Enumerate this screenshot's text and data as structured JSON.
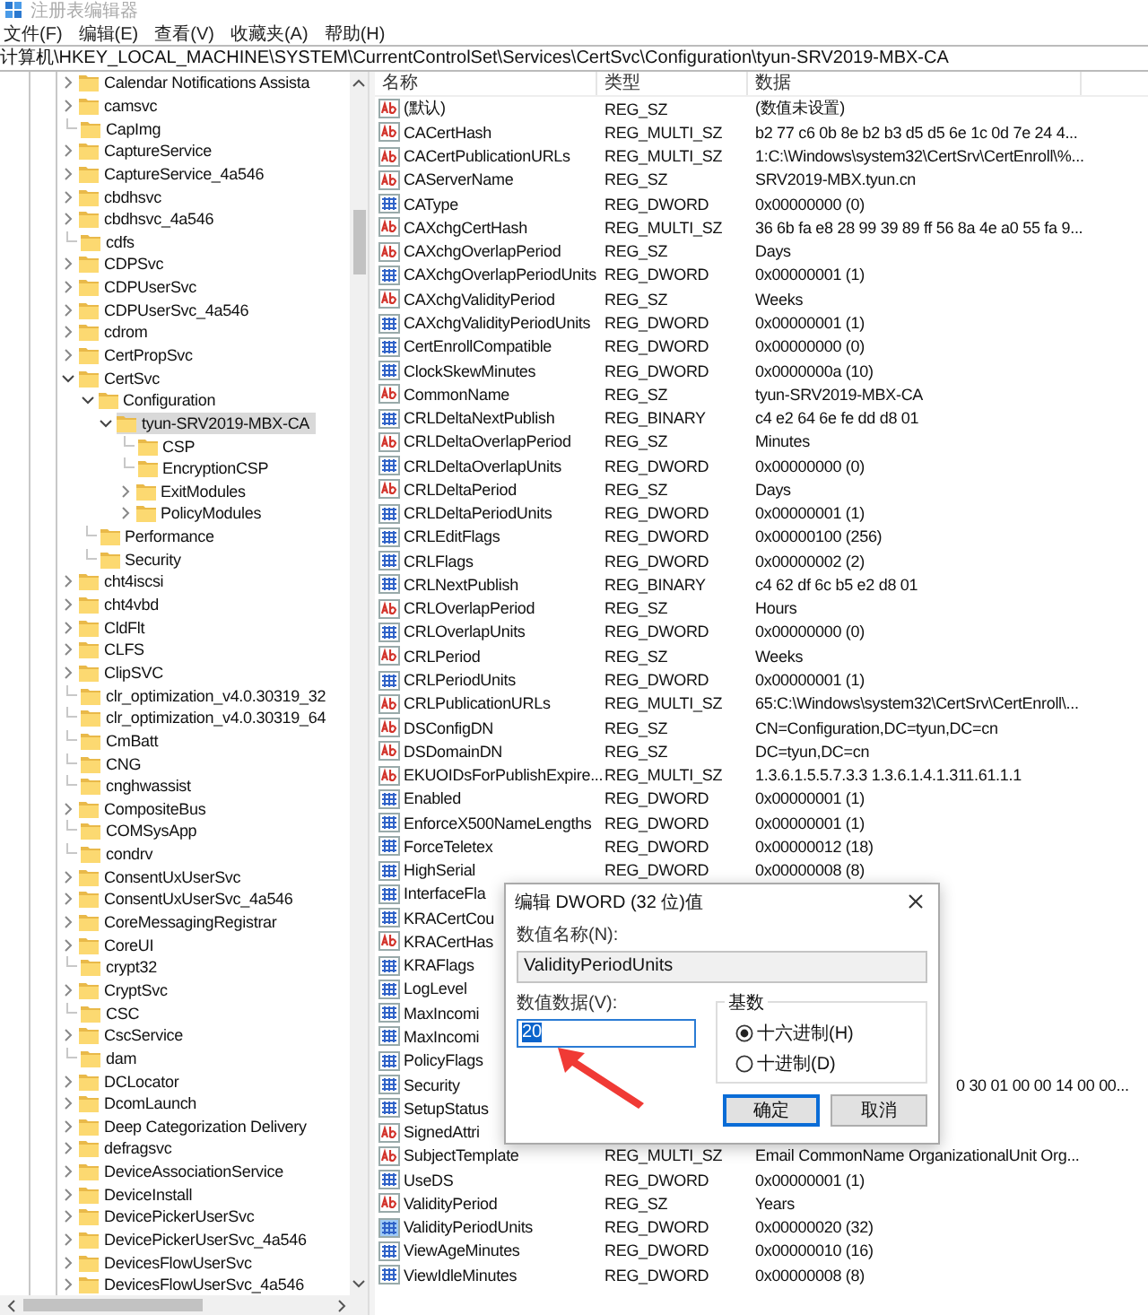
{
  "window": {
    "title": "注册表编辑器"
  },
  "menu": [
    "文件(F)",
    "编辑(E)",
    "查看(V)",
    "收藏夹(A)",
    "帮助(H)"
  ],
  "address": "计算机\\HKEY_LOCAL_MACHINE\\SYSTEM\\CurrentControlSet\\Services\\CertSvc\\Configuration\\tyun-SRV2019-MBX-CA",
  "tree": {
    "items": [
      {
        "label": "Calendar Notifications Assista",
        "kind": "collapsed",
        "selected": false
      },
      {
        "label": "camsvc",
        "kind": "collapsed",
        "selected": false
      },
      {
        "label": "CapImg",
        "kind": "leaf",
        "selected": false
      },
      {
        "label": "CaptureService",
        "kind": "collapsed",
        "selected": false
      },
      {
        "label": "CaptureService_4a546",
        "kind": "collapsed",
        "selected": false
      },
      {
        "label": "cbdhsvc",
        "kind": "collapsed",
        "selected": false
      },
      {
        "label": "cbdhsvc_4a546",
        "kind": "collapsed",
        "selected": false
      },
      {
        "label": "cdfs",
        "kind": "leaf",
        "selected": false
      },
      {
        "label": "CDPSvc",
        "kind": "collapsed",
        "selected": false
      },
      {
        "label": "CDPUserSvc",
        "kind": "collapsed",
        "selected": false
      },
      {
        "label": "CDPUserSvc_4a546",
        "kind": "collapsed",
        "selected": false
      },
      {
        "label": "cdrom",
        "kind": "collapsed",
        "selected": false
      },
      {
        "label": "CertPropSvc",
        "kind": "collapsed",
        "selected": false
      },
      {
        "label": "CertSvc",
        "kind": "expanded",
        "selected": false,
        "children": [
          {
            "label": "Configuration",
            "kind": "expanded",
            "selected": false,
            "children": [
              {
                "label": "tyun-SRV2019-MBX-CA",
                "kind": "expanded",
                "selected": true,
                "children": [
                  {
                    "label": "CSP",
                    "kind": "leaf",
                    "selected": false
                  },
                  {
                    "label": "EncryptionCSP",
                    "kind": "leaf",
                    "selected": false
                  },
                  {
                    "label": "ExitModules",
                    "kind": "collapsed",
                    "selected": false
                  },
                  {
                    "label": "PolicyModules",
                    "kind": "collapsed",
                    "selected": false
                  }
                ]
              }
            ]
          },
          {
            "label": "Performance",
            "kind": "leaf",
            "selected": false
          },
          {
            "label": "Security",
            "kind": "leaf",
            "selected": false
          }
        ]
      },
      {
        "label": "cht4iscsi",
        "kind": "collapsed",
        "selected": false
      },
      {
        "label": "cht4vbd",
        "kind": "collapsed",
        "selected": false
      },
      {
        "label": "CldFlt",
        "kind": "collapsed",
        "selected": false
      },
      {
        "label": "CLFS",
        "kind": "collapsed",
        "selected": false
      },
      {
        "label": "ClipSVC",
        "kind": "collapsed",
        "selected": false
      },
      {
        "label": "clr_optimization_v4.0.30319_32",
        "kind": "leaf",
        "selected": false
      },
      {
        "label": "clr_optimization_v4.0.30319_64",
        "kind": "leaf",
        "selected": false
      },
      {
        "label": "CmBatt",
        "kind": "leaf",
        "selected": false
      },
      {
        "label": "CNG",
        "kind": "leaf",
        "selected": false
      },
      {
        "label": "cnghwassist",
        "kind": "leaf",
        "selected": false
      },
      {
        "label": "CompositeBus",
        "kind": "collapsed",
        "selected": false
      },
      {
        "label": "COMSysApp",
        "kind": "leaf",
        "selected": false
      },
      {
        "label": "condrv",
        "kind": "leaf",
        "selected": false
      },
      {
        "label": "ConsentUxUserSvc",
        "kind": "collapsed",
        "selected": false
      },
      {
        "label": "ConsentUxUserSvc_4a546",
        "kind": "collapsed",
        "selected": false
      },
      {
        "label": "CoreMessagingRegistrar",
        "kind": "collapsed",
        "selected": false
      },
      {
        "label": "CoreUI",
        "kind": "collapsed",
        "selected": false
      },
      {
        "label": "crypt32",
        "kind": "leaf",
        "selected": false
      },
      {
        "label": "CryptSvc",
        "kind": "collapsed",
        "selected": false
      },
      {
        "label": "CSC",
        "kind": "leaf",
        "selected": false
      },
      {
        "label": "CscService",
        "kind": "collapsed",
        "selected": false
      },
      {
        "label": "dam",
        "kind": "leaf",
        "selected": false
      },
      {
        "label": "DCLocator",
        "kind": "collapsed",
        "selected": false
      },
      {
        "label": "DcomLaunch",
        "kind": "collapsed",
        "selected": false
      },
      {
        "label": "Deep Categorization Delivery",
        "kind": "collapsed",
        "selected": false
      },
      {
        "label": "defragsvc",
        "kind": "collapsed",
        "selected": false
      },
      {
        "label": "DeviceAssociationService",
        "kind": "collapsed",
        "selected": false
      },
      {
        "label": "DeviceInstall",
        "kind": "collapsed",
        "selected": false
      },
      {
        "label": "DevicePickerUserSvc",
        "kind": "collapsed",
        "selected": false
      },
      {
        "label": "DevicePickerUserSvc_4a546",
        "kind": "collapsed",
        "selected": false
      },
      {
        "label": "DevicesFlowUserSvc",
        "kind": "collapsed",
        "selected": false
      },
      {
        "label": "DevicesFlowUserSvc_4a546",
        "kind": "collapsed",
        "selected": false
      }
    ]
  },
  "values": {
    "columns": [
      "名称",
      "类型",
      "数据"
    ],
    "rows": [
      {
        "kind": "string",
        "name": "(默认)",
        "type": "REG_SZ",
        "data": "(数值未设置)",
        "selected": false
      },
      {
        "kind": "string",
        "name": "CACertHash",
        "type": "REG_MULTI_SZ",
        "data": "b2 77 c6 0b 8e b2 b3 d5 d5 6e 1c 0d 7e 24 4...",
        "selected": false
      },
      {
        "kind": "string",
        "name": "CACertPublicationURLs",
        "type": "REG_MULTI_SZ",
        "data": "1:C:\\Windows\\system32\\CertSrv\\CertEnroll\\%...",
        "selected": false
      },
      {
        "kind": "string",
        "name": "CAServerName",
        "type": "REG_SZ",
        "data": "SRV2019-MBX.tyun.cn",
        "selected": false
      },
      {
        "kind": "number",
        "name": "CAType",
        "type": "REG_DWORD",
        "data": "0x00000000 (0)",
        "selected": false
      },
      {
        "kind": "string",
        "name": "CAXchgCertHash",
        "type": "REG_MULTI_SZ",
        "data": "36 6b fa e8 28 99 39 89 ff 56 8a 4e a0 55 fa 9...",
        "selected": false
      },
      {
        "kind": "string",
        "name": "CAXchgOverlapPeriod",
        "type": "REG_SZ",
        "data": "Days",
        "selected": false
      },
      {
        "kind": "number",
        "name": "CAXchgOverlapPeriodUnits",
        "type": "REG_DWORD",
        "data": "0x00000001 (1)",
        "selected": false
      },
      {
        "kind": "string",
        "name": "CAXchgValidityPeriod",
        "type": "REG_SZ",
        "data": "Weeks",
        "selected": false
      },
      {
        "kind": "number",
        "name": "CAXchgValidityPeriodUnits",
        "type": "REG_DWORD",
        "data": "0x00000001 (1)",
        "selected": false
      },
      {
        "kind": "number",
        "name": "CertEnrollCompatible",
        "type": "REG_DWORD",
        "data": "0x00000000 (0)",
        "selected": false
      },
      {
        "kind": "number",
        "name": "ClockSkewMinutes",
        "type": "REG_DWORD",
        "data": "0x0000000a (10)",
        "selected": false
      },
      {
        "kind": "string",
        "name": "CommonName",
        "type": "REG_SZ",
        "data": "tyun-SRV2019-MBX-CA",
        "selected": false
      },
      {
        "kind": "number",
        "name": "CRLDeltaNextPublish",
        "type": "REG_BINARY",
        "data": "c4 e2 64 6e fe dd d8 01",
        "selected": false
      },
      {
        "kind": "string",
        "name": "CRLDeltaOverlapPeriod",
        "type": "REG_SZ",
        "data": "Minutes",
        "selected": false
      },
      {
        "kind": "number",
        "name": "CRLDeltaOverlapUnits",
        "type": "REG_DWORD",
        "data": "0x00000000 (0)",
        "selected": false
      },
      {
        "kind": "string",
        "name": "CRLDeltaPeriod",
        "type": "REG_SZ",
        "data": "Days",
        "selected": false
      },
      {
        "kind": "number",
        "name": "CRLDeltaPeriodUnits",
        "type": "REG_DWORD",
        "data": "0x00000001 (1)",
        "selected": false
      },
      {
        "kind": "number",
        "name": "CRLEditFlags",
        "type": "REG_DWORD",
        "data": "0x00000100 (256)",
        "selected": false
      },
      {
        "kind": "number",
        "name": "CRLFlags",
        "type": "REG_DWORD",
        "data": "0x00000002 (2)",
        "selected": false
      },
      {
        "kind": "number",
        "name": "CRLNextPublish",
        "type": "REG_BINARY",
        "data": "c4 62 df 6c b5 e2 d8 01",
        "selected": false
      },
      {
        "kind": "string",
        "name": "CRLOverlapPeriod",
        "type": "REG_SZ",
        "data": "Hours",
        "selected": false
      },
      {
        "kind": "number",
        "name": "CRLOverlapUnits",
        "type": "REG_DWORD",
        "data": "0x00000000 (0)",
        "selected": false
      },
      {
        "kind": "string",
        "name": "CRLPeriod",
        "type": "REG_SZ",
        "data": "Weeks",
        "selected": false
      },
      {
        "kind": "number",
        "name": "CRLPeriodUnits",
        "type": "REG_DWORD",
        "data": "0x00000001 (1)",
        "selected": false
      },
      {
        "kind": "string",
        "name": "CRLPublicationURLs",
        "type": "REG_MULTI_SZ",
        "data": "65:C:\\Windows\\system32\\CertSrv\\CertEnroll\\...",
        "selected": false
      },
      {
        "kind": "string",
        "name": "DSConfigDN",
        "type": "REG_SZ",
        "data": "CN=Configuration,DC=tyun,DC=cn",
        "selected": false
      },
      {
        "kind": "string",
        "name": "DSDomainDN",
        "type": "REG_SZ",
        "data": "DC=tyun,DC=cn",
        "selected": false
      },
      {
        "kind": "string",
        "name": "EKUOIDsForPublishExpire...",
        "type": "REG_MULTI_SZ",
        "data": "1.3.6.1.5.5.7.3.3 1.3.6.1.4.1.311.61.1.1",
        "selected": false
      },
      {
        "kind": "number",
        "name": "Enabled",
        "type": "REG_DWORD",
        "data": "0x00000001 (1)",
        "selected": false
      },
      {
        "kind": "number",
        "name": "EnforceX500NameLengths",
        "type": "REG_DWORD",
        "data": "0x00000001 (1)",
        "selected": false
      },
      {
        "kind": "number",
        "name": "ForceTeletex",
        "type": "REG_DWORD",
        "data": "0x00000012 (18)",
        "selected": false
      },
      {
        "kind": "number",
        "name": "HighSerial",
        "type": "REG_DWORD",
        "data": "0x00000008 (8)",
        "selected": false
      },
      {
        "kind": "number",
        "name": "InterfaceFla",
        "selected": false
      },
      {
        "kind": "number",
        "name": "KRACertCou",
        "selected": false
      },
      {
        "kind": "string",
        "name": "KRACertHas",
        "selected": false
      },
      {
        "kind": "number",
        "name": "KRAFlags",
        "selected": false
      },
      {
        "kind": "number",
        "name": "LogLevel",
        "selected": false
      },
      {
        "kind": "number",
        "name": "MaxIncomi",
        "selected": false
      },
      {
        "kind": "number",
        "name": "MaxIncomi",
        "selected": false
      },
      {
        "kind": "number",
        "name": "PolicyFlags",
        "selected": false
      },
      {
        "kind": "number",
        "name": "Security",
        "data": "0 30 01 00 00 14 00 00...",
        "selected": false
      },
      {
        "kind": "number",
        "name": "SetupStatus",
        "selected": false
      },
      {
        "kind": "string",
        "name": "SignedAttri",
        "selected": false
      },
      {
        "kind": "string",
        "name": "SubjectTemplate",
        "type": "REG_MULTI_SZ",
        "data": "Email CommonName OrganizationalUnit Org...",
        "selected": false
      },
      {
        "kind": "number",
        "name": "UseDS",
        "type": "REG_DWORD",
        "data": "0x00000001 (1)",
        "selected": false
      },
      {
        "kind": "string",
        "name": "ValidityPeriod",
        "type": "REG_SZ",
        "data": "Years",
        "selected": false
      },
      {
        "kind": "number",
        "name": "ValidityPeriodUnits",
        "type": "REG_DWORD",
        "data": "0x00000020 (32)",
        "selected": true
      },
      {
        "kind": "number",
        "name": "ViewAgeMinutes",
        "type": "REG_DWORD",
        "data": "0x00000010 (16)",
        "selected": false
      },
      {
        "kind": "number",
        "name": "ViewIdleMinutes",
        "type": "REG_DWORD",
        "data": "0x00000008 (8)",
        "selected": false
      }
    ]
  },
  "dialog": {
    "title": "编辑 DWORD (32 位)值",
    "name_label": "数值名称(N):",
    "name_value": "ValidityPeriodUnits",
    "data_label": "数值数据(V):",
    "data_value": "20",
    "data_value_selected": true,
    "base_label": "基数",
    "radios": [
      {
        "label": "十六进制(H)",
        "selected": true
      },
      {
        "label": "十进制(D)",
        "selected": false
      }
    ],
    "buttons": [
      {
        "label": "确定",
        "default": true
      },
      {
        "label": "取消",
        "default": false
      }
    ]
  }
}
